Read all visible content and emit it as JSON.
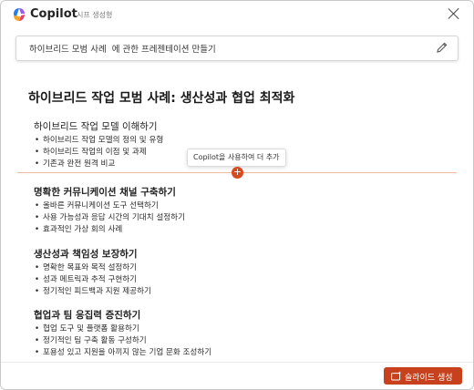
{
  "app": {
    "title": "Copilot",
    "subtitle": "시프 생성형"
  },
  "prompt": {
    "text": "하이브리드 모범 사례  에 관한 프레젠테이션 만들기"
  },
  "deck_title": "하이브리드 작업 모범 사례: 생산성과 협업 최적화",
  "sections": [
    {
      "title": "하이브리드 작업 모델 이해하기",
      "bullets": [
        "하이브리드 작업 모델의 정의 및 유형",
        "하이브리드 작업의 이점 및 과제",
        "기존과 완전 원격 비교"
      ]
    },
    {
      "title": "명확한 커뮤니케이션 채널 구축하기",
      "bullets": [
        "올바른 커뮤니케이션 도구 선택하기",
        "사용 가능성과 응답 시간의 기대치 설정하기",
        "효과적인 가상 회의 사례"
      ]
    },
    {
      "title": "생산성과 책임성 보장하기",
      "bullets": [
        "명확한 목표와 목적 설정하기",
        "성과 메트릭과 추적 구현하기",
        "정기적인 피드백과 지원 제공하기"
      ]
    },
    {
      "title": "협업과 팀 응집력 증진하기",
      "bullets": [
        "협업 도구 및 플랫폼 활용하기",
        "정기적인 팀 구축 활동 구성하기",
        "포용성 있고 지원을 아끼지 않는 기업 문화 조성하기"
      ]
    }
  ],
  "insert_tooltip": "Copilot을 사용하여 더 추가",
  "insert_button": "+",
  "create_button": {
    "label": "슬라이드 생성",
    "icon": "slides-sparkle-icon"
  },
  "colors": {
    "accent": "#c7421c",
    "insert_line": "#f0b8a8"
  }
}
